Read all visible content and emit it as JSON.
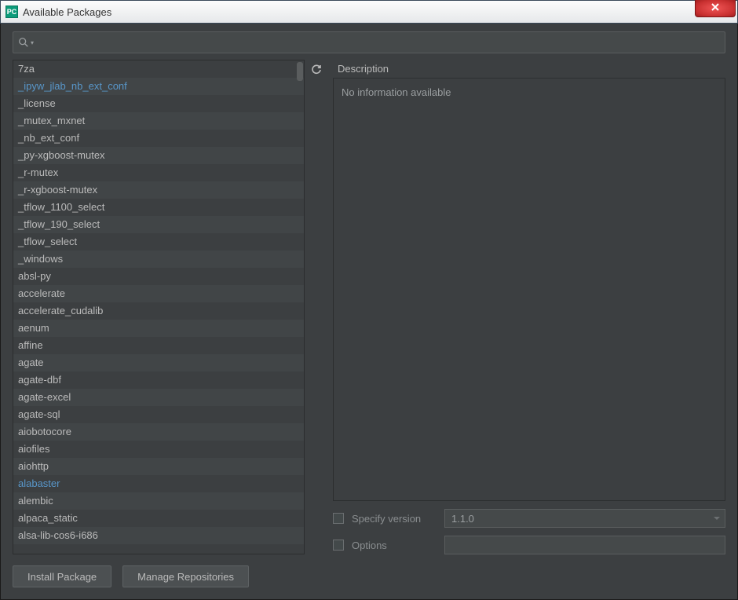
{
  "window": {
    "title": "Available Packages"
  },
  "search": {
    "value": ""
  },
  "packages": [
    {
      "name": "7za"
    },
    {
      "name": "_ipyw_jlab_nb_ext_conf",
      "highlight": true
    },
    {
      "name": "_license"
    },
    {
      "name": "_mutex_mxnet"
    },
    {
      "name": "_nb_ext_conf"
    },
    {
      "name": "_py-xgboost-mutex"
    },
    {
      "name": "_r-mutex"
    },
    {
      "name": "_r-xgboost-mutex"
    },
    {
      "name": "_tflow_1100_select"
    },
    {
      "name": "_tflow_190_select"
    },
    {
      "name": "_tflow_select"
    },
    {
      "name": "_windows"
    },
    {
      "name": "absl-py"
    },
    {
      "name": "accelerate"
    },
    {
      "name": "accelerate_cudalib"
    },
    {
      "name": "aenum"
    },
    {
      "name": "affine"
    },
    {
      "name": "agate"
    },
    {
      "name": "agate-dbf"
    },
    {
      "name": "agate-excel"
    },
    {
      "name": "agate-sql"
    },
    {
      "name": "aiobotocore"
    },
    {
      "name": "aiofiles"
    },
    {
      "name": "aiohttp"
    },
    {
      "name": "alabaster",
      "highlight": true
    },
    {
      "name": "alembic"
    },
    {
      "name": "alpaca_static"
    },
    {
      "name": "alsa-lib-cos6-i686"
    }
  ],
  "description": {
    "header": "Description",
    "body": "No information available"
  },
  "controls": {
    "specify_version_label": "Specify version",
    "specify_version_checked": false,
    "version_value": "1.1.0",
    "options_label": "Options",
    "options_checked": false,
    "options_value": ""
  },
  "buttons": {
    "install": "Install Package",
    "manage_repos": "Manage Repositories"
  }
}
